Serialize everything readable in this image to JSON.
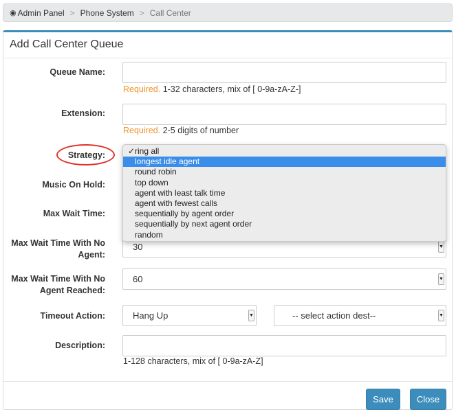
{
  "breadcrumb": {
    "items": [
      "Admin Panel",
      "Phone System",
      "Call Center"
    ]
  },
  "panel": {
    "title": "Add Call Center Queue"
  },
  "form": {
    "queue_name": {
      "label": "Queue Name:",
      "value": "",
      "hint_required": "Required.",
      "hint": "1-32 characters, mix of [ 0-9a-zA-Z-]"
    },
    "extension": {
      "label": "Extension:",
      "value": "",
      "hint_required": "Required.",
      "hint": "2-5 digits of number"
    },
    "strategy": {
      "label": "Strategy:",
      "options": [
        "ring all",
        "longest idle agent",
        "round robin",
        "top down",
        "agent with least talk time",
        "agent with fewest calls",
        "sequentially by agent order",
        "sequentially by next agent order",
        "random"
      ],
      "checked": "ring all",
      "highlighted": "longest idle agent"
    },
    "music_on_hold": {
      "label": "Music On Hold:"
    },
    "max_wait_time": {
      "label": "Max Wait Time:"
    },
    "max_wait_no_agent": {
      "label": "Max Wait Time With No Agent:",
      "value": "30"
    },
    "max_wait_no_agent_reached": {
      "label": "Max Wait Time With No Agent Reached:",
      "value": "60"
    },
    "timeout_action": {
      "label": "Timeout Action:",
      "value": "Hang Up",
      "dest_value": "-- select action dest--"
    },
    "description": {
      "label": "Description:",
      "value": "",
      "hint": "1-128 characters, mix of [ 0-9a-zA-Z]"
    }
  },
  "buttons": {
    "save": "Save",
    "close": "Close"
  },
  "colors": {
    "primary": "#3c8dbc",
    "required": "#f0932b",
    "highlight": "#3a8de8",
    "circle": "#e0312a"
  }
}
